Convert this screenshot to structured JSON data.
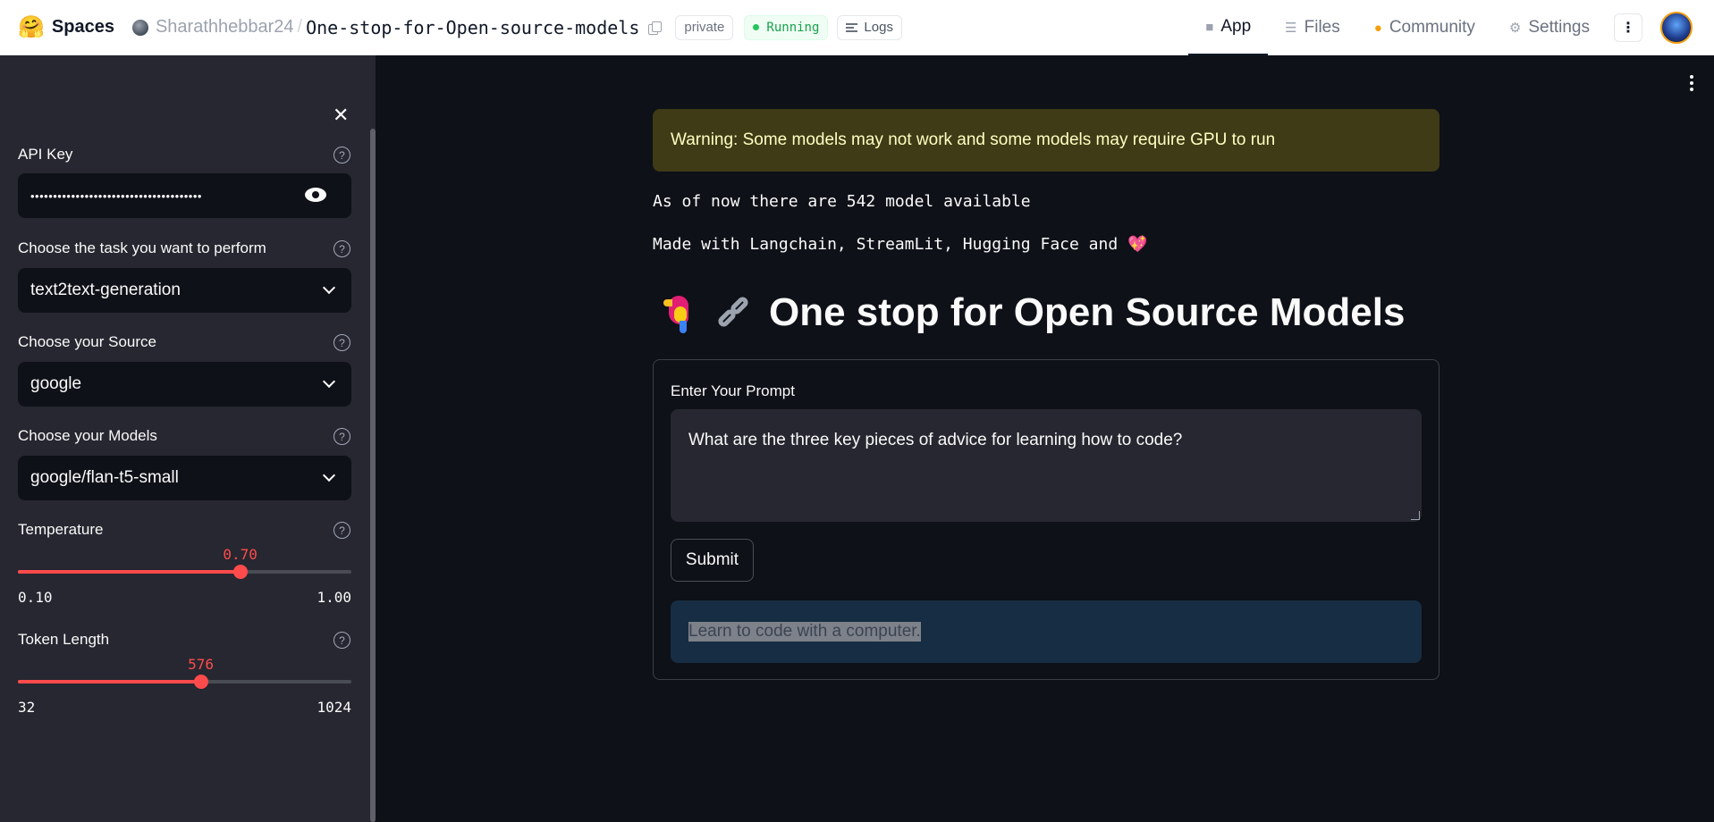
{
  "topbar": {
    "brand": "Spaces",
    "owner": "Sharathhebbar24",
    "separator": "/",
    "repo": "One-stop-for-Open-source-models",
    "visibility": "private",
    "status": "Running",
    "logs_label": "Logs",
    "nav": [
      {
        "label": "App",
        "icon": "cube-icon",
        "active": true
      },
      {
        "label": "Files",
        "icon": "files-icon",
        "active": false
      },
      {
        "label": "Community",
        "icon": "community-icon",
        "active": false
      },
      {
        "label": "Settings",
        "icon": "gear-icon",
        "active": false
      }
    ]
  },
  "sidebar": {
    "api_key": {
      "label": "API Key",
      "value": "••••••••••••••••••••••••••••••••••••••"
    },
    "task": {
      "label": "Choose the task you want to perform",
      "value": "text2text-generation"
    },
    "source": {
      "label": "Choose your Source",
      "value": "google"
    },
    "models": {
      "label": "Choose your Models",
      "value": "google/flan-t5-small"
    },
    "temperature": {
      "label": "Temperature",
      "value": "0.70",
      "min": "0.10",
      "max": "1.00",
      "fraction": 0.6667
    },
    "token_length": {
      "label": "Token Length",
      "value": "576",
      "min": "32",
      "max": "1024",
      "fraction": 0.5484
    }
  },
  "main": {
    "warning": "Warning: Some models may not work and some models may require GPU to run",
    "model_count_line": "As of now there are 542 model available",
    "made_with_line": "Made with Langchain, StreamLit, Hugging Face and",
    "title": "One stop for Open Source Models",
    "prompt_label": "Enter Your Prompt",
    "prompt_value": "What are the three key pieces of advice for learning how to code?",
    "submit_label": "Submit",
    "result": "Learn to code with a computer."
  },
  "colors": {
    "accent": "#ff4b4b",
    "background": "#0e1117",
    "sidebar": "#262730",
    "warning_bg": "#3e3b16",
    "result_bg": "#172d43",
    "running": "#16a34a"
  }
}
